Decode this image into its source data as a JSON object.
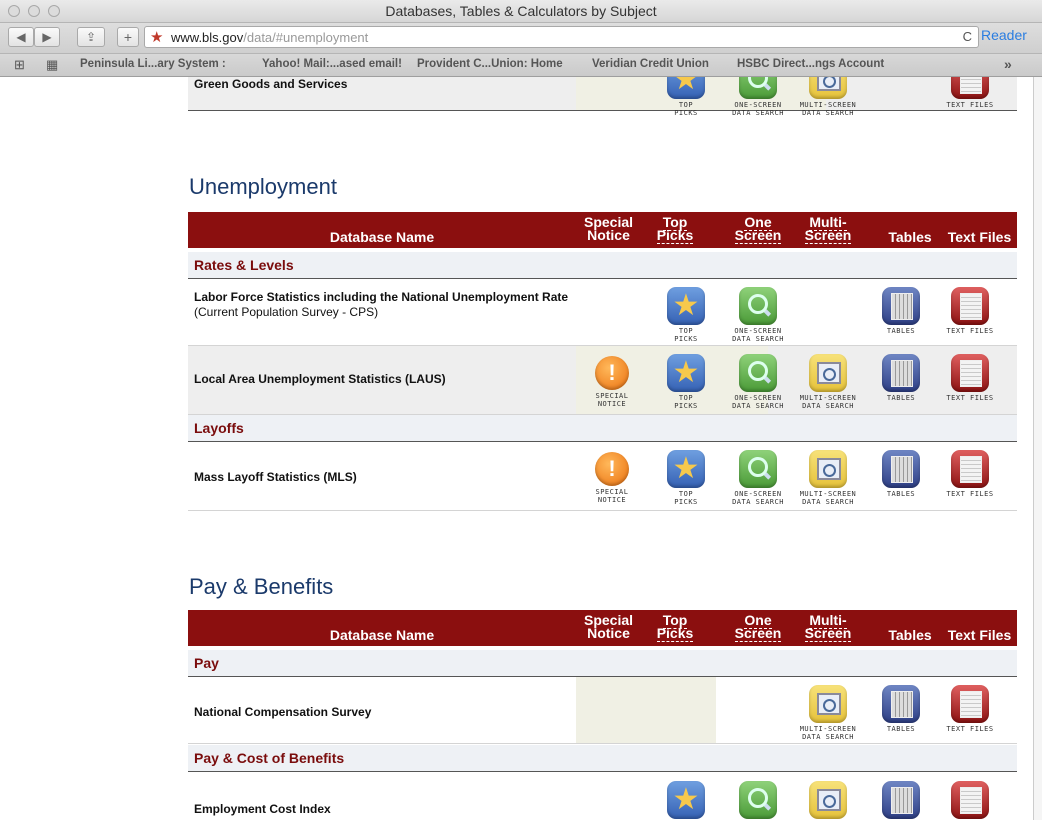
{
  "window": {
    "title": "Databases, Tables & Calculators by Subject"
  },
  "toolbar": {
    "back": "◀",
    "forward": "▶",
    "share": "⇪",
    "add": "+",
    "url_host": "www.bls.gov",
    "url_path": "/data/#unemployment",
    "reload": "C",
    "reader": "Reader"
  },
  "bookmarks": [
    "Peninsula Li...ary System :",
    "Yahoo! Mail:...ased email!",
    "Provident C...Union: Home",
    "Veridian Credit Union",
    "HSBC Direct...ngs Account"
  ],
  "bookmarks_more": "»",
  "top_partial": {
    "label": "Green Goods and Services",
    "icon_labels": {
      "top": "TOP\nPICKS",
      "one": "ONE-SCREEN\nDATA SEARCH",
      "multi": "MULTI-SCREEN\nDATA SEARCH",
      "text": "TEXT FILES"
    }
  },
  "columns": {
    "name": "Database Name",
    "special": "Special Notice",
    "top": "Top Picks",
    "one": "One Screen",
    "multi": "Multi-Screen",
    "tables": "Tables",
    "text": "Text Files"
  },
  "icon_labels": {
    "special": "SPECIAL\nNOTICE",
    "top": "TOP\nPICKS",
    "one": "ONE-SCREEN\nDATA SEARCH",
    "multi": "MULTI-SCREEN\nDATA SEARCH",
    "tables": "TABLES",
    "text": "TEXT FILES"
  },
  "unemployment": {
    "title": "Unemployment",
    "groups": {
      "rates": "Rates & Levels",
      "layoffs": "Layoffs"
    },
    "rows": {
      "lfs_name": "Labor Force Statistics including the National Unemployment Rate",
      "lfs_sub": "(Current Population Survey - CPS)",
      "laus_name": "Local Area Unemployment Statistics (LAUS)",
      "mls_name": "Mass Layoff Statistics (MLS)"
    }
  },
  "pay": {
    "title": "Pay & Benefits",
    "groups": {
      "pay": "Pay",
      "cost": "Pay & Cost of Benefits"
    },
    "rows": {
      "ncs_name": "National Compensation Survey",
      "eci_name": "Employment Cost Index"
    }
  }
}
